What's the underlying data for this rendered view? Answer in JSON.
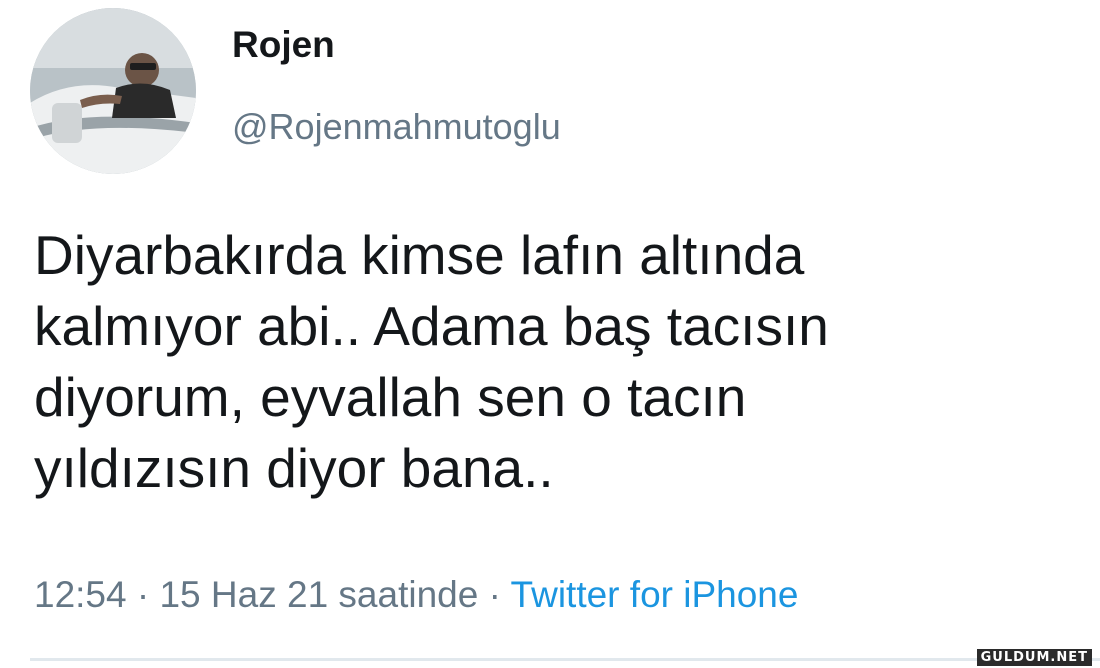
{
  "author": {
    "display_name": "Rojen",
    "handle": "@Rojenmahmutoglu"
  },
  "tweet": {
    "lines": [
      "Diyarbakırda kimse lafın altında",
      "kalmıyor abi.. Adama baş tacısın",
      "diyorum, eyvallah sen o tacın",
      "yıldızısın diyor bana.."
    ]
  },
  "meta": {
    "time": "12:54",
    "separator_1": " · ",
    "date": "15 Haz 21 saatinde",
    "separator_2": " · ",
    "source": "Twitter for iPhone"
  },
  "watermark": "GULDUM.NET",
  "colors": {
    "text": "#14171a",
    "secondary": "#657786",
    "link": "#1b95e0",
    "divider": "#e1e8ed"
  }
}
